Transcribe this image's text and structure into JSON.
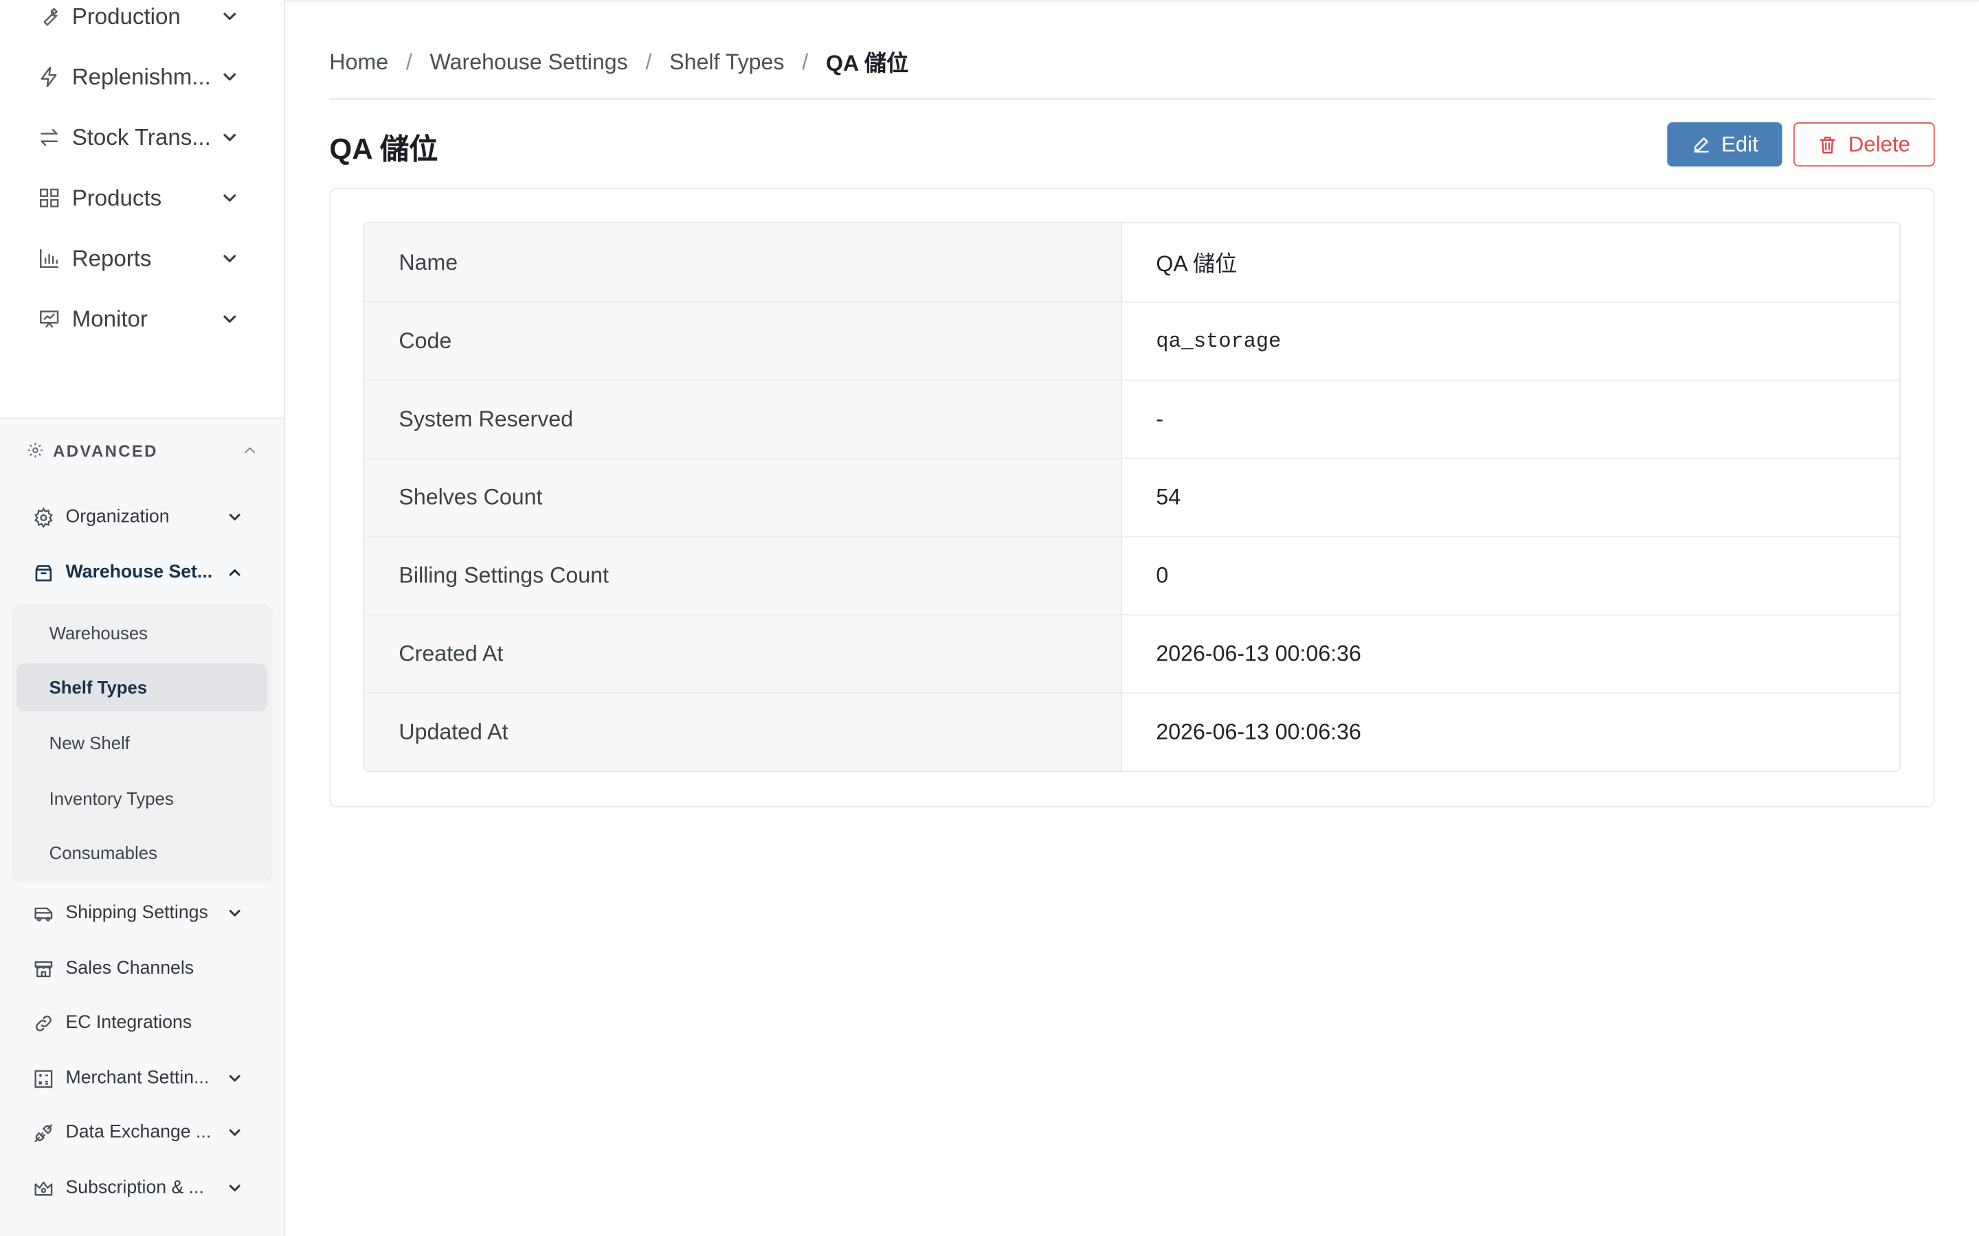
{
  "sidebar": {
    "main_items": [
      {
        "label": "Production",
        "icon": "wrench-icon"
      },
      {
        "label": "Replenishm...",
        "icon": "lightning-icon"
      },
      {
        "label": "Stock Trans...",
        "icon": "transfer-arrows-icon"
      },
      {
        "label": "Products",
        "icon": "grid-icon"
      },
      {
        "label": "Reports",
        "icon": "bar-chart-icon"
      },
      {
        "label": "Monitor",
        "icon": "monitor-chart-icon"
      }
    ],
    "advanced_section": {
      "label": "ADVANCED",
      "items": [
        {
          "label": "Organization",
          "icon": "gear-icon"
        },
        {
          "label": "Warehouse Set...",
          "icon": "box-icon"
        },
        {
          "label": "Shipping Settings",
          "icon": "truck-icon"
        },
        {
          "label": "Sales Channels",
          "icon": "store-icon"
        },
        {
          "label": "EC Integrations",
          "icon": "link-icon"
        },
        {
          "label": "Merchant Settin...",
          "icon": "calculator-icon"
        },
        {
          "label": "Data Exchange ...",
          "icon": "plug-icon"
        },
        {
          "label": "Subscription & ...",
          "icon": "crown-icon"
        }
      ],
      "warehouse_submenu": [
        {
          "label": "Warehouses"
        },
        {
          "label": "Shelf Types"
        },
        {
          "label": "New Shelf"
        },
        {
          "label": "Inventory Types"
        },
        {
          "label": "Consumables"
        }
      ]
    }
  },
  "breadcrumb": {
    "items": [
      "Home",
      "Warehouse Settings",
      "Shelf Types"
    ],
    "current": "QA 儲位",
    "separator": "/"
  },
  "page": {
    "title": "QA 儲位",
    "edit_label": "Edit",
    "delete_label": "Delete"
  },
  "details": [
    {
      "label": "Name",
      "value": "QA 儲位"
    },
    {
      "label": "Code",
      "value": "qa_storage"
    },
    {
      "label": "System Reserved",
      "value": "-"
    },
    {
      "label": "Shelves Count",
      "value": "54"
    },
    {
      "label": "Billing Settings Count",
      "value": "0"
    },
    {
      "label": "Created At",
      "value": "2026-06-13 00:06:36"
    },
    {
      "label": "Updated At",
      "value": "2026-06-13 00:06:36"
    }
  ],
  "colors": {
    "primary": "#4a7fb5",
    "danger": "#e04a4a",
    "active_text": "#16324a"
  }
}
